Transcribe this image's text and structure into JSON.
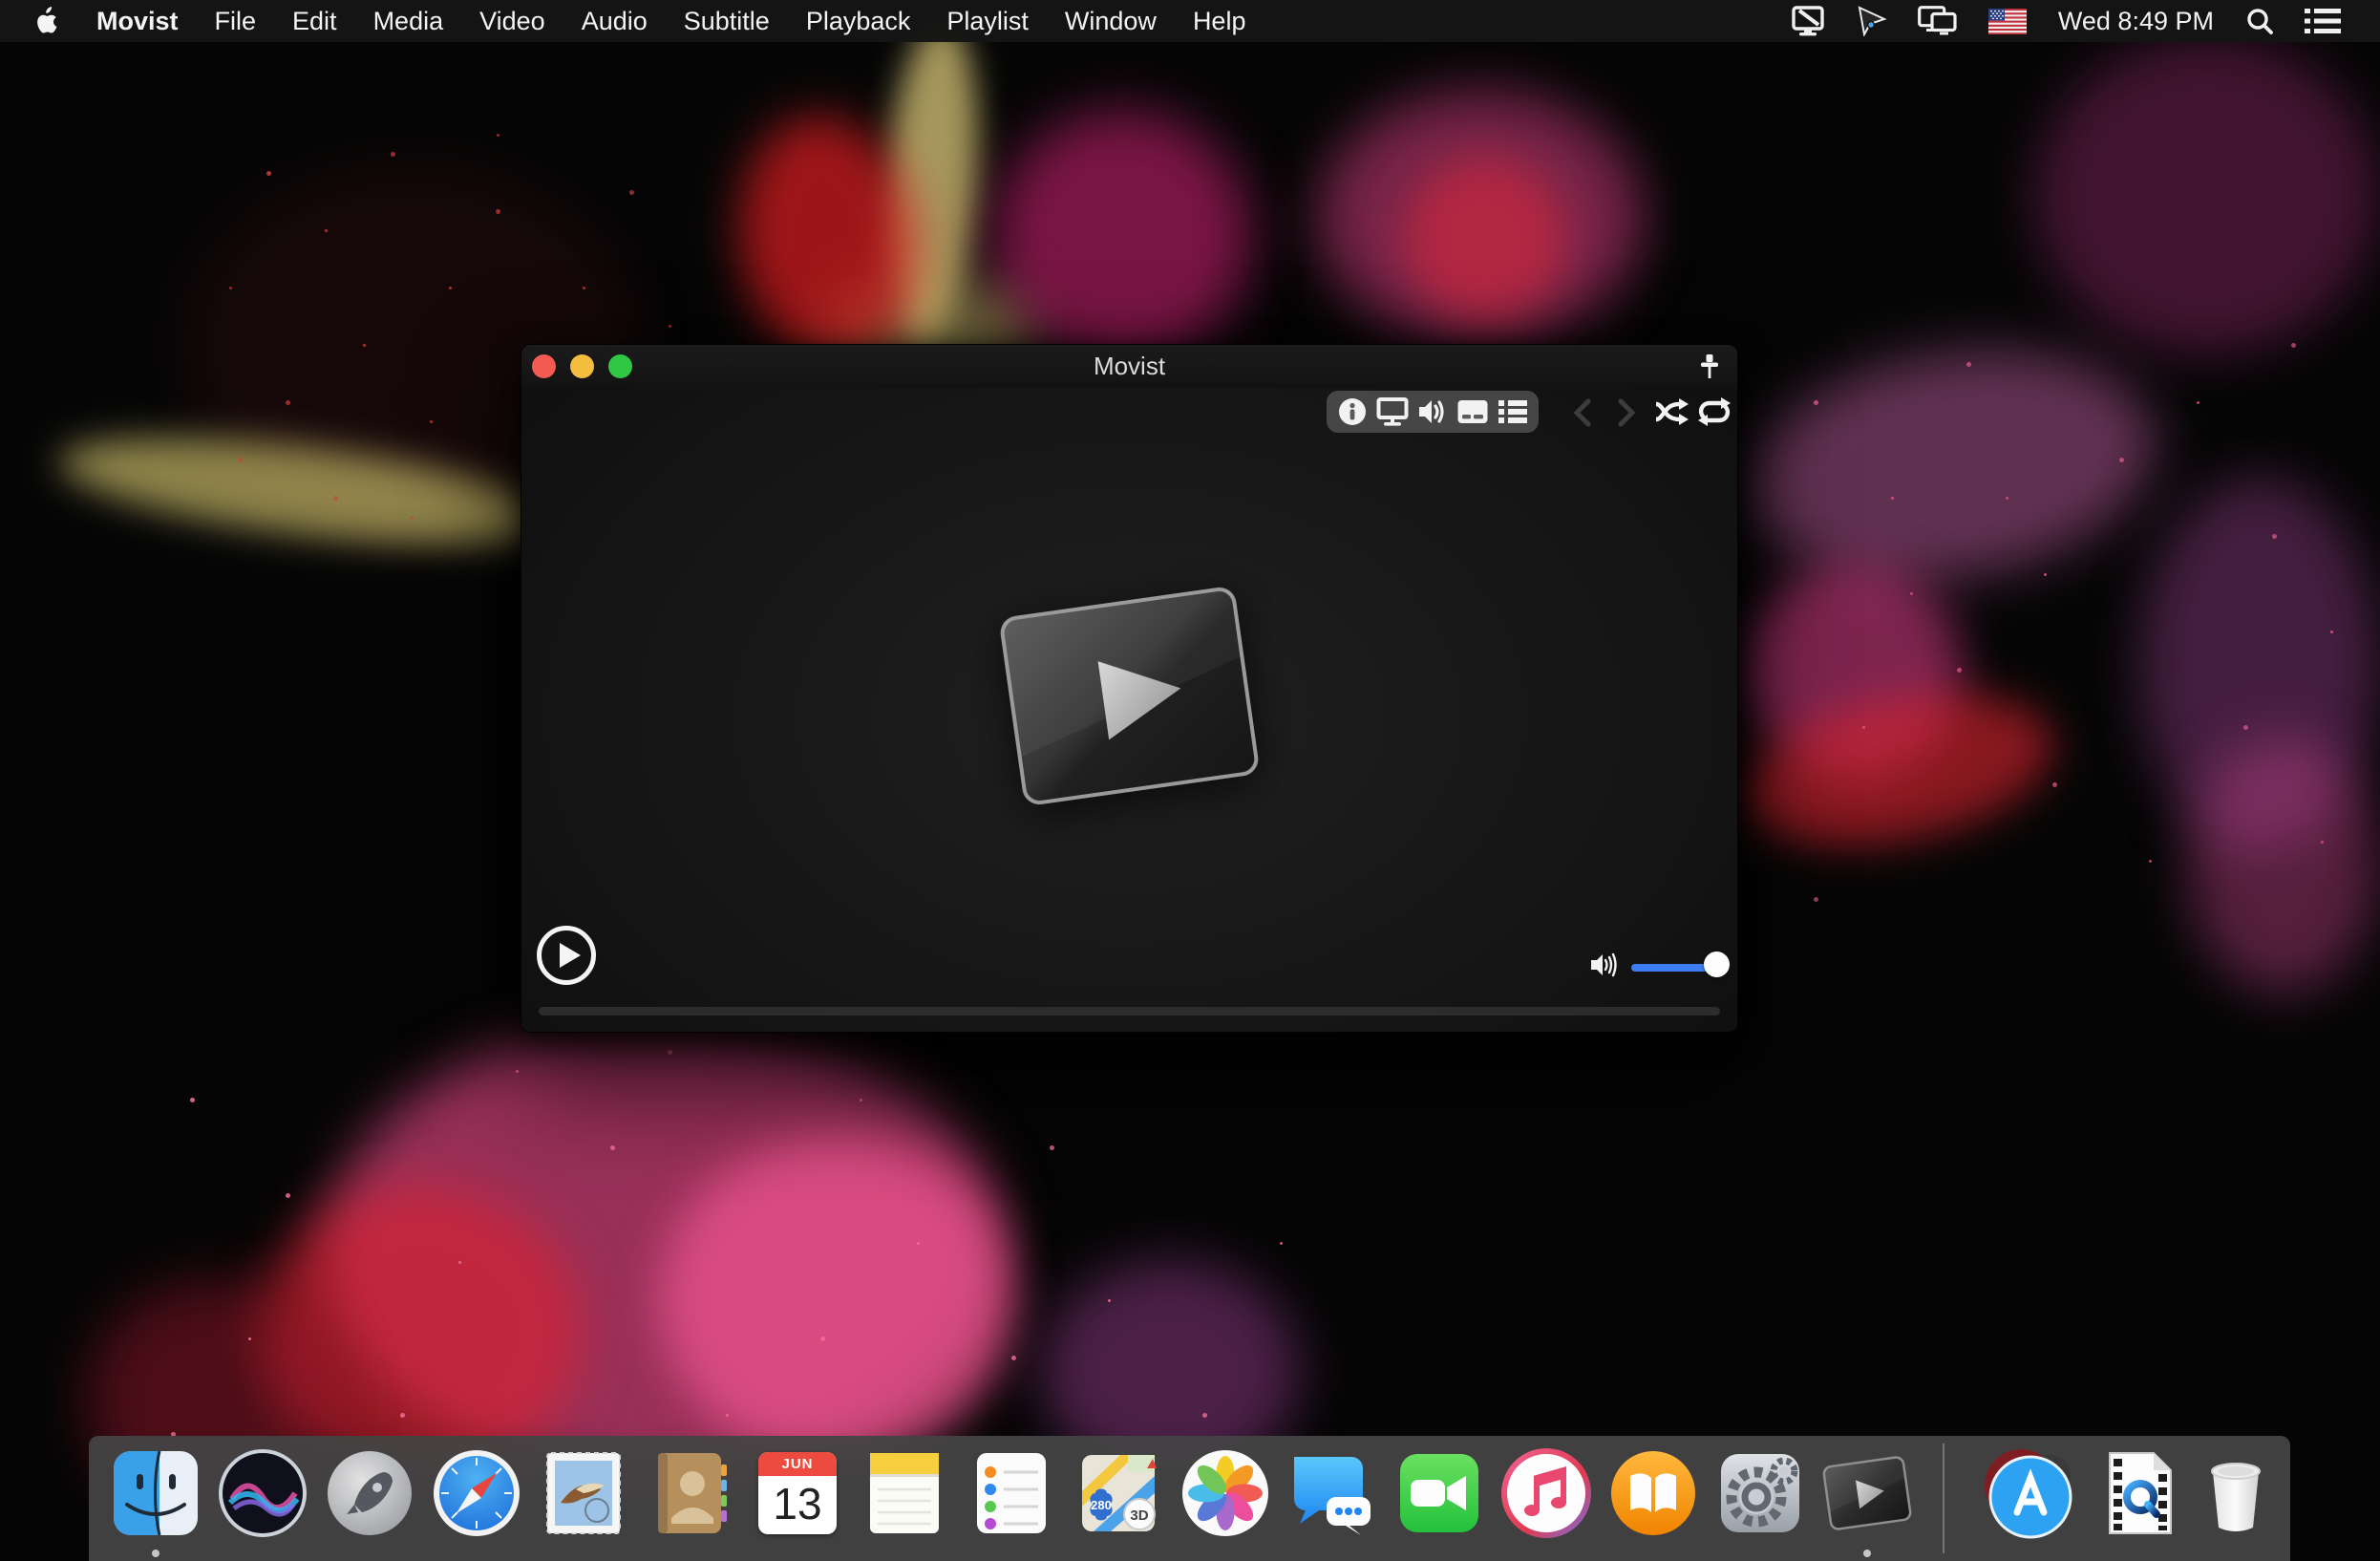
{
  "menu_bar": {
    "menus": [
      "Movist",
      "File",
      "Edit",
      "Media",
      "Video",
      "Audio",
      "Subtitle",
      "Playback",
      "Playlist",
      "Window",
      "Help"
    ],
    "status": {
      "clock": "Wed 8:49 PM",
      "icons": [
        "pen-display-icon",
        "pointer-icon",
        "display-mirroring-icon",
        "us-flag-icon",
        "spotlight-search-icon",
        "notification-list-icon"
      ]
    }
  },
  "window": {
    "title": "Movist",
    "traffic_lights": [
      "close",
      "minimize",
      "zoom"
    ],
    "toolbar_icons": [
      "media-info-icon",
      "video-screen-icon",
      "audio-volume-icon",
      "subtitle-icon",
      "playlist-icon"
    ],
    "nav_icons": [
      "chevron-left-icon",
      "chevron-right-icon",
      "shuffle-icon",
      "repeat-icon"
    ],
    "pin_icon": "pushpin-icon",
    "controls": {
      "play_icon": "play-icon",
      "volume_level_percent": 100,
      "seek_position_percent": 0
    }
  },
  "dock": {
    "items": [
      {
        "name": "finder",
        "running": true
      },
      {
        "name": "siri",
        "running": false
      },
      {
        "name": "launchpad",
        "running": false
      },
      {
        "name": "safari",
        "running": false
      },
      {
        "name": "mail",
        "running": false
      },
      {
        "name": "contacts",
        "running": false
      },
      {
        "name": "calendar",
        "running": false
      },
      {
        "name": "notes",
        "running": false
      },
      {
        "name": "reminders",
        "running": false
      },
      {
        "name": "maps",
        "running": false
      },
      {
        "name": "photos",
        "running": false
      },
      {
        "name": "messages",
        "running": false
      },
      {
        "name": "facetime",
        "running": false
      },
      {
        "name": "itunes",
        "running": false
      },
      {
        "name": "ibooks",
        "running": false
      },
      {
        "name": "system-preferences",
        "running": false
      },
      {
        "name": "movist",
        "running": true
      },
      {
        "name": "separator"
      },
      {
        "name": "app-store-stack",
        "running": false
      },
      {
        "name": "movie-file",
        "running": false
      },
      {
        "name": "trash",
        "running": false
      }
    ],
    "calendar": {
      "month": "JUN",
      "day": "13"
    },
    "maps": {
      "route": "280",
      "mode": "3D"
    }
  },
  "colors": {
    "accent_blue": "#3c7ef2",
    "menu_bg": "#151515",
    "dock_bg": "#434343",
    "light_red": "#f25a52",
    "light_yellow": "#f5bd3e",
    "light_green": "#31c643"
  }
}
